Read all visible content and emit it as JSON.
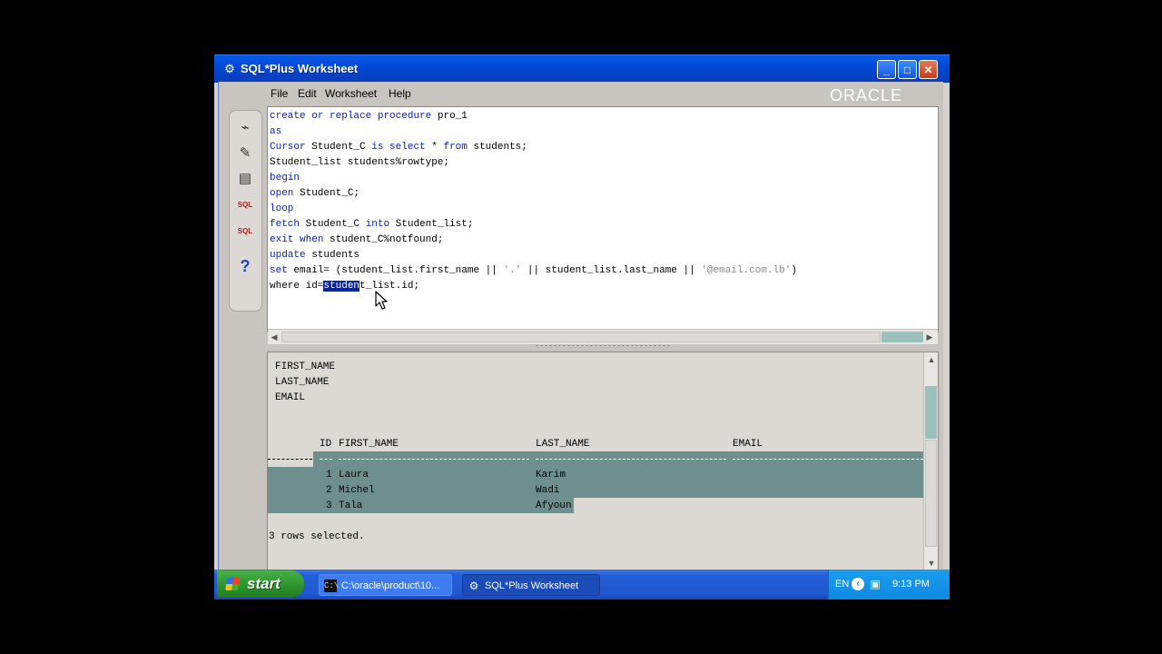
{
  "window": {
    "title": "SQL*Plus Worksheet",
    "min_glyph": "_",
    "max_glyph": "□",
    "close_glyph": "✕"
  },
  "menu": {
    "file": "File",
    "edit": "Edit",
    "worksheet": "Worksheet",
    "help": "Help",
    "brand": "ORACLE"
  },
  "toolbar": [
    {
      "name": "connect-icon",
      "glyph": "⌁"
    },
    {
      "name": "execute-icon",
      "glyph": "✎"
    },
    {
      "name": "history-icon",
      "glyph": "▤"
    },
    {
      "name": "sql-prev-icon",
      "glyph": "SQL"
    },
    {
      "name": "sql-next-icon",
      "glyph": "SQL"
    },
    {
      "name": "help-icon",
      "glyph": "?"
    }
  ],
  "editor": {
    "lines": [
      "create or replace procedure pro_1",
      "as",
      "Cursor Student_C is select * from students;",
      "Student_list students%rowtype;",
      "begin",
      "open Student_C;",
      "loop",
      "fetch Student_C into Student_list;",
      "exit when student_C%notfound;",
      "update students",
      "set email= (student_list.first_name || '.' || student_list.last_name || '@email.com.lb')",
      "where id=student_list.id;"
    ],
    "selected_text": "studen"
  },
  "results": {
    "describe_cols": [
      "FIRST_NAME",
      "LAST_NAME",
      "EMAIL"
    ],
    "headers": {
      "id": "ID",
      "first_name": "FIRST_NAME",
      "last_name": "LAST_NAME",
      "email": "EMAIL"
    },
    "rows": [
      {
        "id": "1",
        "first_name": "Laura",
        "last_name": "Karim",
        "email": ""
      },
      {
        "id": "2",
        "first_name": "Michel",
        "last_name": "Wadi",
        "email": ""
      },
      {
        "id": "3",
        "first_name": "Tala",
        "last_name": "Afyoun",
        "email": ""
      }
    ],
    "footer": "3 rows selected."
  },
  "taskbar": {
    "start": "start",
    "tasks": [
      {
        "label": "C:\\oracle\\product\\10...",
        "icon": "C:\\"
      },
      {
        "label": "SQL*Plus Worksheet",
        "icon": "⚙"
      }
    ],
    "lang": "EN",
    "clock": "9:13 PM"
  },
  "colors": {
    "titlebar": "#0049d8",
    "keyword": "#1020b0",
    "selection": "#0a24a0",
    "result_highlight": "#6f8f8e",
    "start_button": "#2c922c"
  }
}
